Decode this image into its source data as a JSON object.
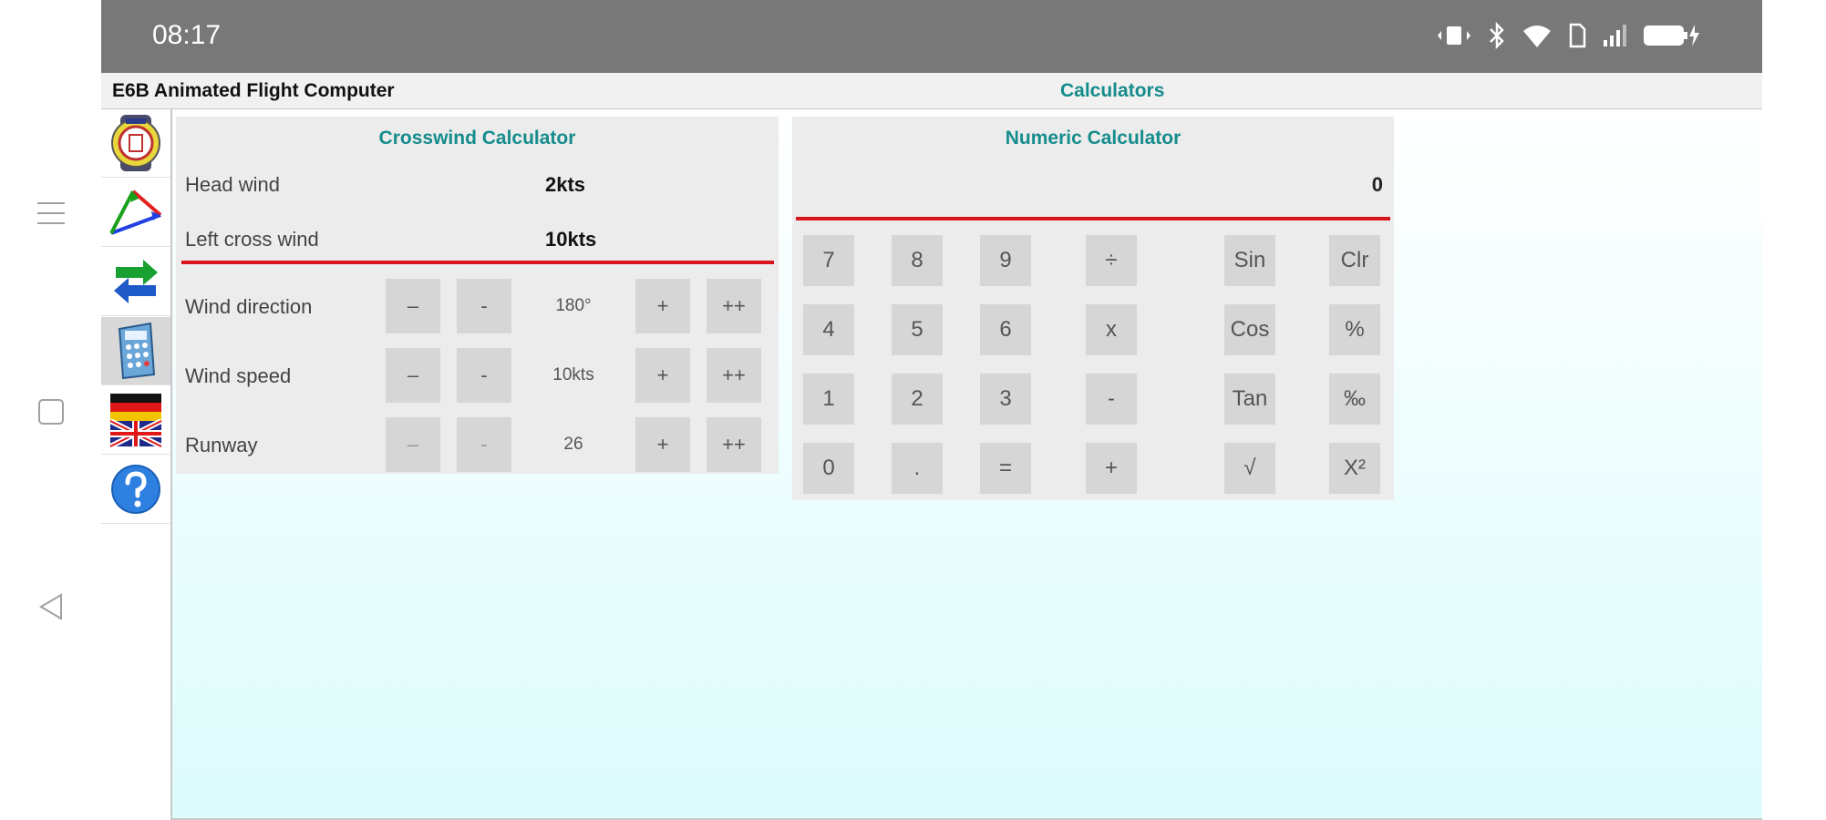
{
  "status": {
    "time": "08:17"
  },
  "app": {
    "title": "E6B Animated Flight Computer",
    "section": "Calculators"
  },
  "sidebar": {
    "items": [
      {
        "icon": "e6b-logo-icon"
      },
      {
        "icon": "wind-triangle-icon"
      },
      {
        "icon": "convert-arrows-icon"
      },
      {
        "icon": "calculator-icon",
        "active": true
      },
      {
        "icon": "language-flags-icon"
      },
      {
        "icon": "help-icon"
      }
    ]
  },
  "crosswind": {
    "title": "Crosswind Calculator",
    "head_wind_label": "Head wind",
    "head_wind_value": "2kts",
    "cross_wind_label": "Left cross wind",
    "cross_wind_value": "10kts",
    "rows": [
      {
        "label": "Wind direction",
        "value": "180°",
        "btn_mm": "–",
        "btn_m": "-",
        "btn_p": "+",
        "btn_pp": "++"
      },
      {
        "label": "Wind speed",
        "value": "10kts",
        "btn_mm": "–",
        "btn_m": "-",
        "btn_p": "+",
        "btn_pp": "++"
      },
      {
        "label": "Runway",
        "value": "26",
        "btn_mm": "–",
        "btn_m": "-",
        "btn_p": "+",
        "btn_pp": "++"
      }
    ]
  },
  "numeric": {
    "title": "Numeric Calculator",
    "display": "0",
    "keys": [
      [
        "7",
        "8",
        "9",
        "÷",
        "Sin",
        "Clr"
      ],
      [
        "4",
        "5",
        "6",
        "x",
        "Cos",
        "%"
      ],
      [
        "1",
        "2",
        "3",
        "-",
        "Tan",
        "‰"
      ],
      [
        "0",
        ".",
        "=",
        "+",
        "√",
        "X²"
      ]
    ]
  },
  "colors": {
    "accent": "#168c8c",
    "divider": "#d9141c",
    "statusbar": "#787878"
  }
}
